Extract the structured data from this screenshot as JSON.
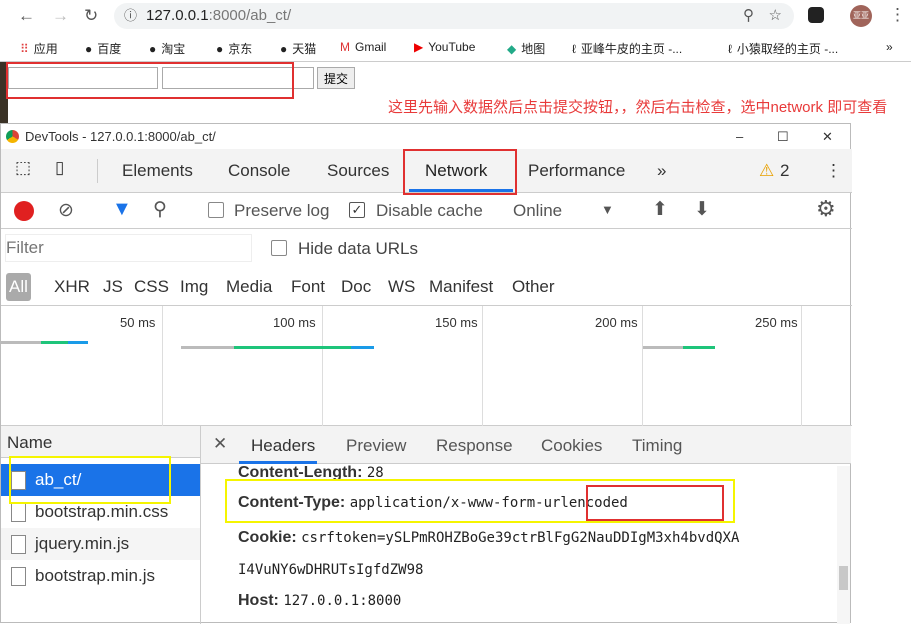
{
  "browser": {
    "url_host": "127.0.0.1",
    "url_rest": ":8000/ab_ct/",
    "profile": "亚亚"
  },
  "bookmarks": [
    {
      "icon": "apps-icon",
      "label": "应用"
    },
    {
      "icon": "globe-icon",
      "label": "百度"
    },
    {
      "icon": "globe-icon",
      "label": "淘宝"
    },
    {
      "icon": "globe-icon",
      "label": "京东"
    },
    {
      "icon": "globe-icon",
      "label": "天猫"
    },
    {
      "icon": "gmail-icon",
      "label": "Gmail"
    },
    {
      "icon": "youtube-icon",
      "label": "YouTube"
    },
    {
      "icon": "maps-icon",
      "label": "地图"
    },
    {
      "icon": "user-icon",
      "label": "亚峰牛皮的主页 -..."
    },
    {
      "icon": "user-icon",
      "label": "小猿取经的主页 -..."
    }
  ],
  "page": {
    "submit_label": "提交",
    "annotation": "这里先输入数据然后点击提交按钮，，然后右击检查，选中network 即可查看content-type"
  },
  "devtools": {
    "title": "DevTools - 127.0.0.1:8000/ab_ct/",
    "tabs": [
      "Elements",
      "Console",
      "Sources",
      "Network",
      "Performance"
    ],
    "active_tab": "Network",
    "warnings": "2",
    "preserve_log": "Preserve log",
    "preserve_checked": false,
    "disable_cache": "Disable cache",
    "disable_checked": true,
    "throttle": "Online",
    "filter_placeholder": "Filter",
    "hide_data_urls": "Hide data URLs",
    "types": [
      "All",
      "XHR",
      "JS",
      "CSS",
      "Img",
      "Media",
      "Font",
      "Doc",
      "WS",
      "Manifest",
      "Other"
    ],
    "timeline_ticks": [
      "50 ms",
      "100 ms",
      "150 ms",
      "200 ms",
      "250 ms"
    ],
    "name_header": "Name",
    "requests": [
      "ab_ct/",
      "bootstrap.min.css",
      "jquery.min.js",
      "bootstrap.min.js"
    ],
    "selected_request": "ab_ct/",
    "detail_tabs": [
      "Headers",
      "Preview",
      "Response",
      "Cookies",
      "Timing"
    ],
    "headers": [
      {
        "name": "Content-Length:",
        "value": "28"
      },
      {
        "name": "Content-Type:",
        "value_a": "application/x-www-form-",
        "value_b": "urlencoded"
      },
      {
        "name": "Cookie:",
        "value": "csrftoken=ySLPmROHZBoGe39ctrBlFgG2NauDDIgM3xh4bvdQXA",
        "value2": "I4VuNY6wDHRUTsIgfdZW98"
      },
      {
        "name": "Host:",
        "value": "127.0.0.1:8000"
      }
    ]
  },
  "colors": {
    "annotation_red": "#e83a3a",
    "highlight_yellow": "#f5f500",
    "selected_blue": "#1a73e8",
    "record_red": "#e02020",
    "accent_blue": "#1a73e8"
  }
}
